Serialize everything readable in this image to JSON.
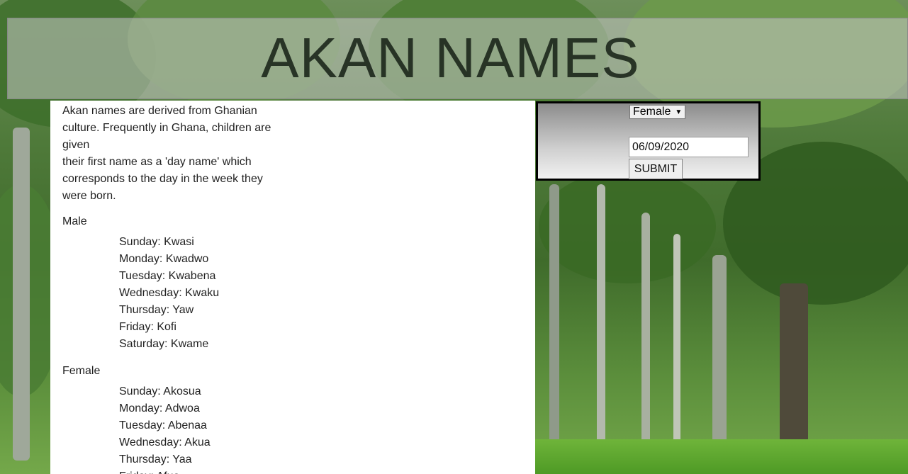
{
  "header": {
    "title": "AKAN NAMES"
  },
  "intro": {
    "lines": [
      "Akan names are derived from Ghanian",
      "culture. Frequently in Ghana, children are",
      "given",
      "their first name as a 'day name' which",
      "corresponds to the day in the week they",
      "were born."
    ]
  },
  "male": {
    "title": "Male",
    "names": [
      "Sunday: Kwasi",
      "Monday: Kwadwo",
      "Tuesday: Kwabena",
      "Wednesday: Kwaku",
      "Thursday: Yaw",
      "Friday: Kofi",
      "Saturday: Kwame"
    ]
  },
  "female": {
    "title": "Female",
    "names": [
      "Sunday: Akosua",
      "Monday: Adwoa",
      "Tuesday: Abenaa",
      "Wednesday: Akua",
      "Thursday: Yaa",
      "Friday: Afua"
    ]
  },
  "form": {
    "gender_selected": "Female",
    "date_value": "06/09/2020",
    "submit_label": "SUBMIT"
  }
}
